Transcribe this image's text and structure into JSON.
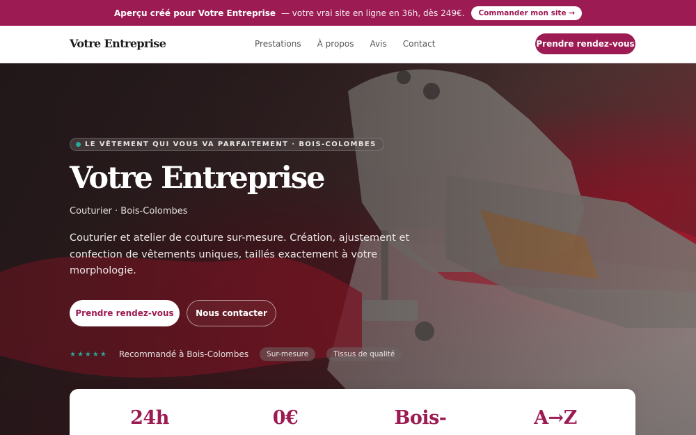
{
  "promo": {
    "strong": "Aperçu créé pour Votre Entreprise",
    "rest": "— votre vrai site en ligne en 36h, dès 249€.",
    "button": "Commander mon site →"
  },
  "nav": {
    "brand": "Votre Entreprise",
    "links": [
      "Prestations",
      "À propos",
      "Avis",
      "Contact"
    ],
    "cta": "Prendre rendez-vous"
  },
  "hero": {
    "kicker": "LE VÊTEMENT QUI VOUS VA PARFAITEMENT · BOIS-COLOMBES",
    "title": "Votre Entreprise",
    "subtitle": "Couturier · Bois-Colombes",
    "description": "Couturier et atelier de couture sur-mesure. Création, ajustement et confection de vêtements uniques, taillés exactement à votre morphologie.",
    "primary_button": "Prendre rendez-vous",
    "secondary_button": "Nous contacter",
    "stars": "★★★★★",
    "rating": 5,
    "proof_text": "Recommandé à Bois-Colombes",
    "chips": [
      "Sur-mesure",
      "Tissus de qualité"
    ]
  },
  "stats": [
    "24h",
    "0€",
    "Bois-",
    "A→Z"
  ],
  "colors": {
    "brand": "#9c1b53",
    "accent": "#2aa89a"
  }
}
